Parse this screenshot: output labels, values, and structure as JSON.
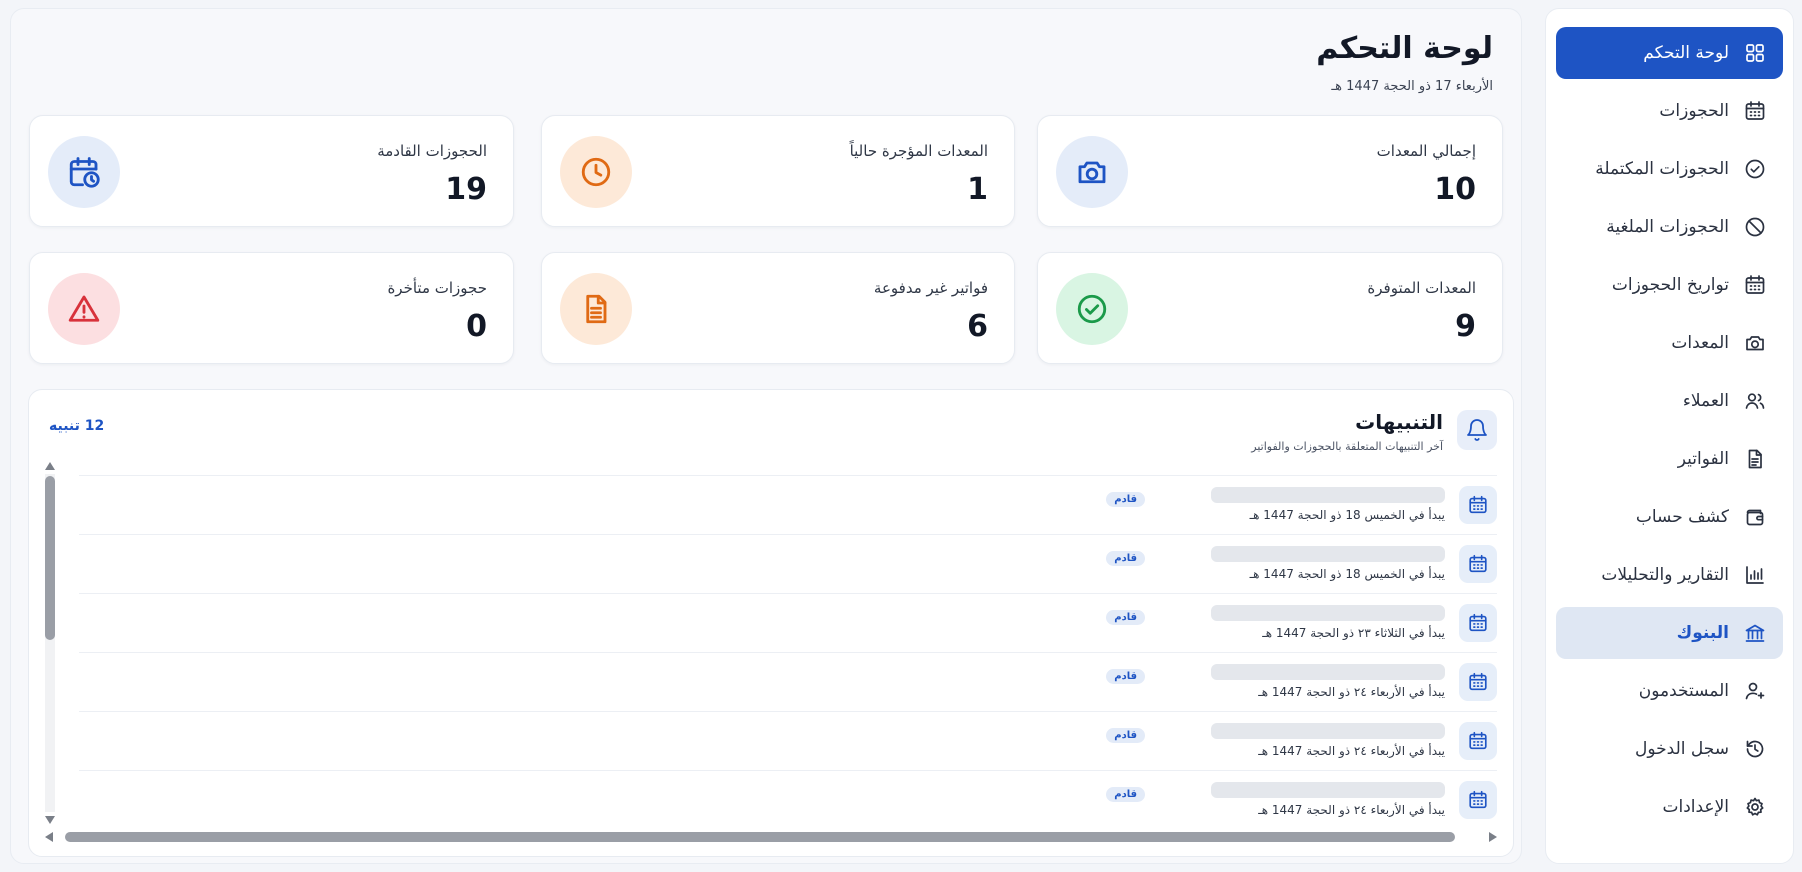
{
  "sidebar": {
    "items": [
      {
        "label": "لوحة التحكم",
        "icon": "grid-icon"
      },
      {
        "label": "الحجوزات",
        "icon": "calendar-icon"
      },
      {
        "label": "الحجوزات المكتملة",
        "icon": "check-circle-icon"
      },
      {
        "label": "الحجوزات الملغية",
        "icon": "ban-icon"
      },
      {
        "label": "تواريخ الحجوزات",
        "icon": "calendar-icon"
      },
      {
        "label": "المعدات",
        "icon": "camera-icon"
      },
      {
        "label": "العملاء",
        "icon": "users-icon"
      },
      {
        "label": "الفواتير",
        "icon": "file-icon"
      },
      {
        "label": "كشف حساب",
        "icon": "wallet-icon"
      },
      {
        "label": "التقارير والتحليلات",
        "icon": "bar-chart-icon"
      },
      {
        "label": "البنوك",
        "icon": "bank-icon"
      },
      {
        "label": "المستخدمون",
        "icon": "user-icon"
      },
      {
        "label": "سجل الدخول",
        "icon": "history-icon"
      },
      {
        "label": "الإعدادات",
        "icon": "gear-icon"
      }
    ],
    "active_index": 0,
    "hover_index": 10
  },
  "header": {
    "title": "لوحة التحكم",
    "date": "الأربعاء 17 ذو الحجة 1447 هـ"
  },
  "stats": [
    {
      "label": "إجمالي المعدات",
      "value": "10",
      "icon": "camera-icon",
      "color": "#1e54c4",
      "bg": "#e4ecf9"
    },
    {
      "label": "المعدات المؤجرة حالياً",
      "value": "1",
      "icon": "clock-icon",
      "color": "#e06a14",
      "bg": "#fde9d8"
    },
    {
      "label": "الحجوزات القادمة",
      "value": "19",
      "icon": "calendar-clock-icon",
      "color": "#1e54c4",
      "bg": "#e4ecf9"
    },
    {
      "label": "المعدات المتوفرة",
      "value": "9",
      "icon": "check-circle-icon",
      "color": "#1b9a4a",
      "bg": "#d9f5e3"
    },
    {
      "label": "فواتير غير مدفوعة",
      "value": "6",
      "icon": "file-text-icon",
      "color": "#e06a14",
      "bg": "#fde9d8"
    },
    {
      "label": "حجوزات متأخرة",
      "value": "0",
      "icon": "alert-triangle-icon",
      "color": "#d8323b",
      "bg": "#fcdfe1"
    }
  ],
  "alerts": {
    "title": "التنبيهات",
    "subtitle": "آخر التنبيهات المتعلقة بالحجوزات والفواتير",
    "count_label": "12 تنبيه",
    "items": [
      {
        "text": "يبدأ في الخميس 18 ذو الحجة 1447 هـ",
        "badge": "قادم"
      },
      {
        "text": "يبدأ في الخميس 18 ذو الحجة 1447 هـ",
        "badge": "قادم"
      },
      {
        "text": "يبدأ في الثلاثاء ٢٣ ذو الحجة 1447 هـ",
        "badge": "قادم"
      },
      {
        "text": "يبدأ في الأربعاء ٢٤ ذو الحجة 1447 هـ",
        "badge": "قادم"
      },
      {
        "text": "يبدأ في الأربعاء ٢٤ ذو الحجة 1447 هـ",
        "badge": "قادم"
      },
      {
        "text": "يبدأ في الأربعاء ٢٤ ذو الحجة 1447 هـ",
        "badge": "قادم"
      }
    ]
  },
  "colors": {
    "accent": "#1e54c4",
    "sidebar_hover": "#dfe7f3"
  }
}
